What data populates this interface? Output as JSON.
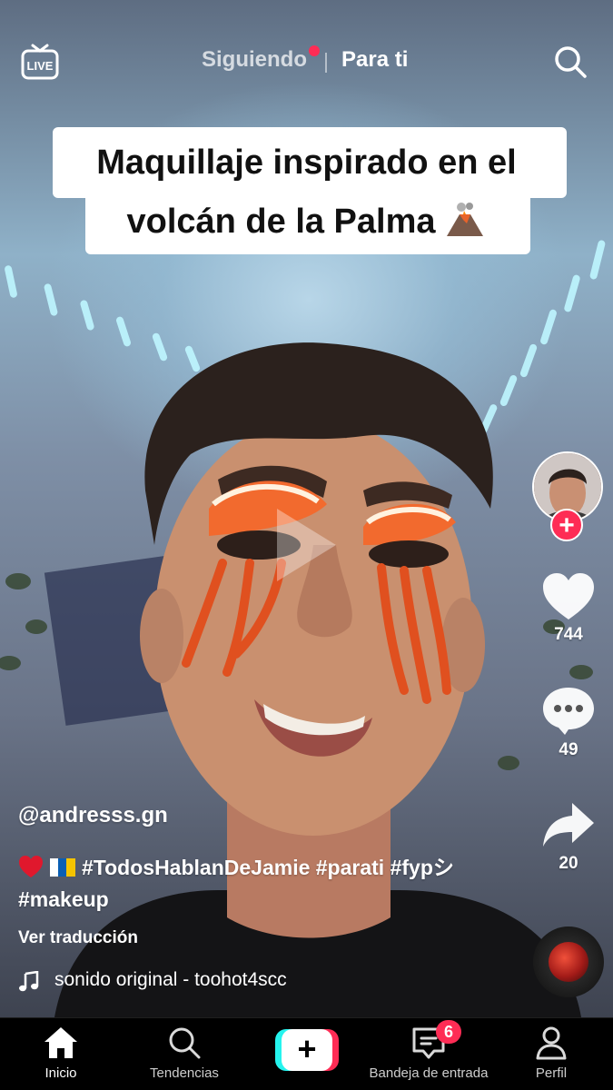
{
  "top_bar": {
    "live_label": "LIVE",
    "tabs": [
      {
        "label": "Siguiendo",
        "active": false,
        "has_dot": true
      },
      {
        "label": "Para ti",
        "active": true
      }
    ]
  },
  "video": {
    "caption_line1": "Maquillaje inspirado en el",
    "caption_line2": "volcán de la Palma",
    "caption_icon": "volcano-icon"
  },
  "rail": {
    "likes": "744",
    "comments": "49",
    "shares": "20"
  },
  "post": {
    "username": "@andresss.gn",
    "description_tags": [
      "#TodosHablanDeJamie",
      "#parati",
      "#fypシ",
      "#makeup"
    ],
    "translate_label": "Ver traducción",
    "sound": "sonido original - toohot4scc"
  },
  "nav": {
    "items": [
      {
        "label": "Inicio",
        "icon": "home-icon",
        "active": true
      },
      {
        "label": "Tendencias",
        "icon": "search-icon"
      },
      {
        "label": "",
        "icon": "plus-icon"
      },
      {
        "label": "Bandeja de entrada",
        "icon": "inbox-icon",
        "badge": "6"
      },
      {
        "label": "Perfil",
        "icon": "profile-icon"
      }
    ]
  },
  "colors": {
    "accent": "#fe2c55",
    "create_cyan": "#25f4ee",
    "background": "#000000"
  }
}
